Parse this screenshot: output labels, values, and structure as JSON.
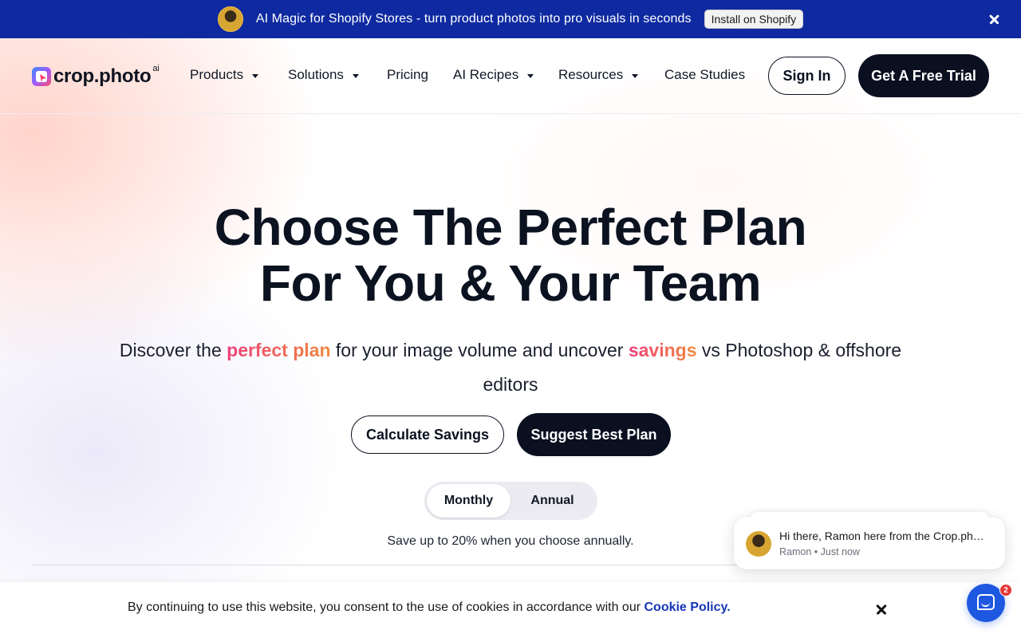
{
  "announcement": {
    "message": "AI Magic for Shopify Stores - turn product photos into pro visuals in seconds",
    "install_label": "Install on Shopify",
    "avatar_icon": "user-avatar"
  },
  "brand": {
    "name": "crop.photo",
    "suffix": "ai"
  },
  "nav": {
    "items": [
      {
        "label": "Products",
        "dropdown": true
      },
      {
        "label": "Solutions",
        "dropdown": true
      },
      {
        "label": "Pricing",
        "dropdown": false
      },
      {
        "label": "AI Recipes",
        "dropdown": true
      },
      {
        "label": "Resources",
        "dropdown": true
      },
      {
        "label": "Case Studies",
        "dropdown": false
      }
    ],
    "sign_in": "Sign In",
    "trial": "Get A Free Trial"
  },
  "hero": {
    "title_line1": "Choose The Perfect Plan",
    "title_line2": "For You & Your Team",
    "sub_part1": "Discover the ",
    "sub_highlight1": "perfect plan",
    "sub_part2": " for your image volume and uncover ",
    "sub_highlight2": "savings",
    "sub_part3": " vs Photoshop & offshore editors",
    "calc_button": "Calculate Savings",
    "suggest_button": "Suggest Best Plan"
  },
  "billing": {
    "monthly": "Monthly",
    "annual": "Annual",
    "selected": "Monthly",
    "note": "Save up to 20% when you choose annually."
  },
  "cookie": {
    "text": "By continuing to use this website, you consent to the use of cookies in accordance with our ",
    "link": "Cookie Policy."
  },
  "chat": {
    "message": "Hi there, Ramon here from the Crop.photo team",
    "meta": "Ramon • Just now",
    "badge_count": "2"
  },
  "colors": {
    "topbar": "#0f2aa0",
    "primary_dark": "#0a1020",
    "highlight_pink": "#ee3f6f",
    "highlight_orange": "#f28a3d",
    "link_blue": "#1636b8",
    "chat_blue": "#1e58e0"
  }
}
